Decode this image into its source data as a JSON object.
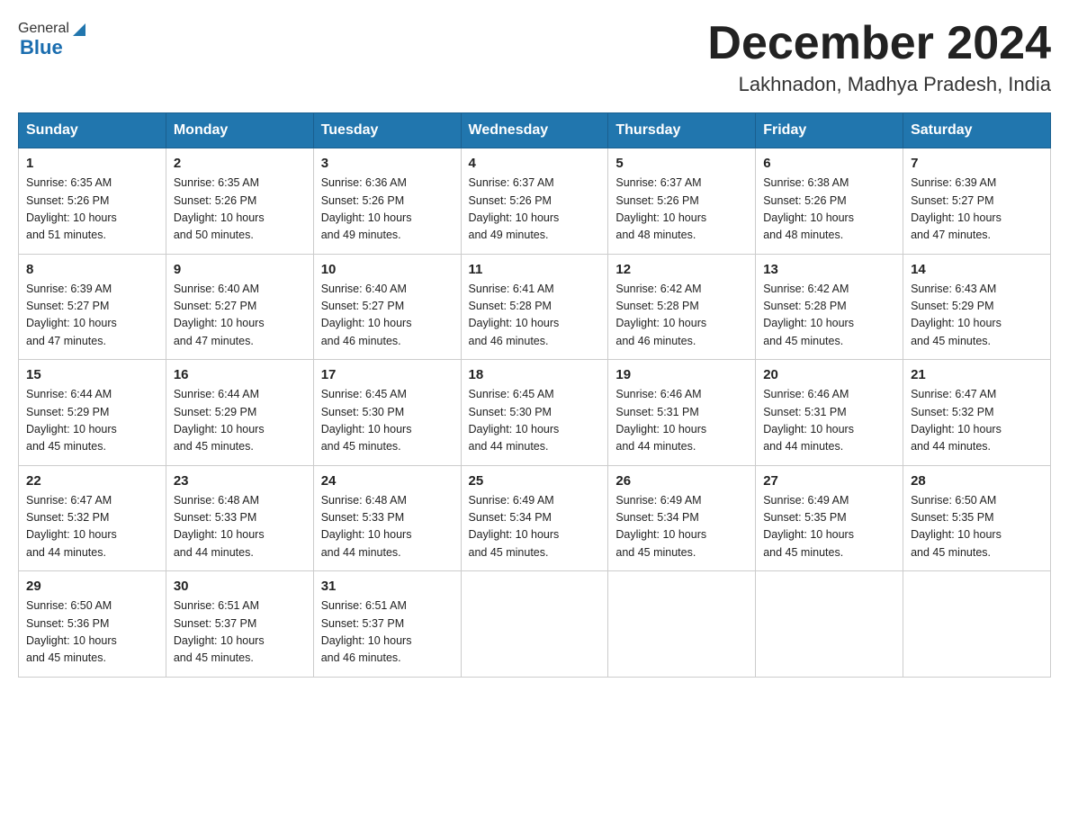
{
  "header": {
    "logo_general": "General",
    "logo_blue": "Blue",
    "month_title": "December 2024",
    "location": "Lakhnadon, Madhya Pradesh, India"
  },
  "days_of_week": [
    "Sunday",
    "Monday",
    "Tuesday",
    "Wednesday",
    "Thursday",
    "Friday",
    "Saturday"
  ],
  "weeks": [
    [
      {
        "day": "1",
        "sunrise": "6:35 AM",
        "sunset": "5:26 PM",
        "daylight": "10 hours and 51 minutes."
      },
      {
        "day": "2",
        "sunrise": "6:35 AM",
        "sunset": "5:26 PM",
        "daylight": "10 hours and 50 minutes."
      },
      {
        "day": "3",
        "sunrise": "6:36 AM",
        "sunset": "5:26 PM",
        "daylight": "10 hours and 49 minutes."
      },
      {
        "day": "4",
        "sunrise": "6:37 AM",
        "sunset": "5:26 PM",
        "daylight": "10 hours and 49 minutes."
      },
      {
        "day": "5",
        "sunrise": "6:37 AM",
        "sunset": "5:26 PM",
        "daylight": "10 hours and 48 minutes."
      },
      {
        "day": "6",
        "sunrise": "6:38 AM",
        "sunset": "5:26 PM",
        "daylight": "10 hours and 48 minutes."
      },
      {
        "day": "7",
        "sunrise": "6:39 AM",
        "sunset": "5:27 PM",
        "daylight": "10 hours and 47 minutes."
      }
    ],
    [
      {
        "day": "8",
        "sunrise": "6:39 AM",
        "sunset": "5:27 PM",
        "daylight": "10 hours and 47 minutes."
      },
      {
        "day": "9",
        "sunrise": "6:40 AM",
        "sunset": "5:27 PM",
        "daylight": "10 hours and 47 minutes."
      },
      {
        "day": "10",
        "sunrise": "6:40 AM",
        "sunset": "5:27 PM",
        "daylight": "10 hours and 46 minutes."
      },
      {
        "day": "11",
        "sunrise": "6:41 AM",
        "sunset": "5:28 PM",
        "daylight": "10 hours and 46 minutes."
      },
      {
        "day": "12",
        "sunrise": "6:42 AM",
        "sunset": "5:28 PM",
        "daylight": "10 hours and 46 minutes."
      },
      {
        "day": "13",
        "sunrise": "6:42 AM",
        "sunset": "5:28 PM",
        "daylight": "10 hours and 45 minutes."
      },
      {
        "day": "14",
        "sunrise": "6:43 AM",
        "sunset": "5:29 PM",
        "daylight": "10 hours and 45 minutes."
      }
    ],
    [
      {
        "day": "15",
        "sunrise": "6:44 AM",
        "sunset": "5:29 PM",
        "daylight": "10 hours and 45 minutes."
      },
      {
        "day": "16",
        "sunrise": "6:44 AM",
        "sunset": "5:29 PM",
        "daylight": "10 hours and 45 minutes."
      },
      {
        "day": "17",
        "sunrise": "6:45 AM",
        "sunset": "5:30 PM",
        "daylight": "10 hours and 45 minutes."
      },
      {
        "day": "18",
        "sunrise": "6:45 AM",
        "sunset": "5:30 PM",
        "daylight": "10 hours and 44 minutes."
      },
      {
        "day": "19",
        "sunrise": "6:46 AM",
        "sunset": "5:31 PM",
        "daylight": "10 hours and 44 minutes."
      },
      {
        "day": "20",
        "sunrise": "6:46 AM",
        "sunset": "5:31 PM",
        "daylight": "10 hours and 44 minutes."
      },
      {
        "day": "21",
        "sunrise": "6:47 AM",
        "sunset": "5:32 PM",
        "daylight": "10 hours and 44 minutes."
      }
    ],
    [
      {
        "day": "22",
        "sunrise": "6:47 AM",
        "sunset": "5:32 PM",
        "daylight": "10 hours and 44 minutes."
      },
      {
        "day": "23",
        "sunrise": "6:48 AM",
        "sunset": "5:33 PM",
        "daylight": "10 hours and 44 minutes."
      },
      {
        "day": "24",
        "sunrise": "6:48 AM",
        "sunset": "5:33 PM",
        "daylight": "10 hours and 44 minutes."
      },
      {
        "day": "25",
        "sunrise": "6:49 AM",
        "sunset": "5:34 PM",
        "daylight": "10 hours and 45 minutes."
      },
      {
        "day": "26",
        "sunrise": "6:49 AM",
        "sunset": "5:34 PM",
        "daylight": "10 hours and 45 minutes."
      },
      {
        "day": "27",
        "sunrise": "6:49 AM",
        "sunset": "5:35 PM",
        "daylight": "10 hours and 45 minutes."
      },
      {
        "day": "28",
        "sunrise": "6:50 AM",
        "sunset": "5:35 PM",
        "daylight": "10 hours and 45 minutes."
      }
    ],
    [
      {
        "day": "29",
        "sunrise": "6:50 AM",
        "sunset": "5:36 PM",
        "daylight": "10 hours and 45 minutes."
      },
      {
        "day": "30",
        "sunrise": "6:51 AM",
        "sunset": "5:37 PM",
        "daylight": "10 hours and 45 minutes."
      },
      {
        "day": "31",
        "sunrise": "6:51 AM",
        "sunset": "5:37 PM",
        "daylight": "10 hours and 46 minutes."
      },
      null,
      null,
      null,
      null
    ]
  ],
  "labels": {
    "sunrise": "Sunrise:",
    "sunset": "Sunset:",
    "daylight": "Daylight:"
  }
}
